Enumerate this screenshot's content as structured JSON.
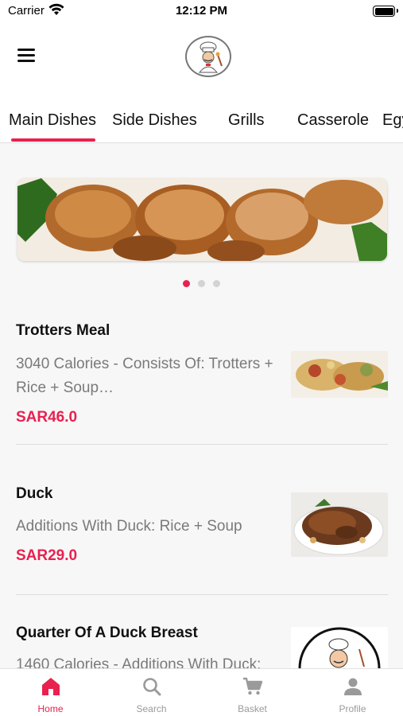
{
  "status_bar": {
    "carrier": "Carrier",
    "time": "12:12 PM"
  },
  "header": {
    "menu_icon": "hamburger-menu-icon",
    "logo": "chef-logo"
  },
  "tabs": [
    {
      "label": "Main Dishes",
      "active": true
    },
    {
      "label": "Side Dishes"
    },
    {
      "label": "Grills"
    },
    {
      "label": "Casserole"
    },
    {
      "label": "Egy"
    }
  ],
  "carousel": {
    "page_count": 3,
    "active_index": 0
  },
  "items": [
    {
      "name": "Trotters Meal",
      "description": "3040 Calories - Consists Of: Trotters + Rice + Soup…",
      "price": "SAR46.0"
    },
    {
      "name": "Duck",
      "description": "Additions With Duck: Rice + Soup",
      "price": "SAR29.0"
    },
    {
      "name": "Quarter Of A Duck Breast",
      "description": "1460 Calories - Additions With Duck:"
    }
  ],
  "bottom_nav": [
    {
      "label": "Home",
      "icon": "home-icon",
      "active": true
    },
    {
      "label": "Search",
      "icon": "search-icon"
    },
    {
      "label": "Basket",
      "icon": "cart-icon"
    },
    {
      "label": "Profile",
      "icon": "profile-icon"
    }
  ],
  "colors": {
    "accent": "#e8214f",
    "muted_text": "#7a7a7a",
    "background": "#f7f7f7"
  }
}
